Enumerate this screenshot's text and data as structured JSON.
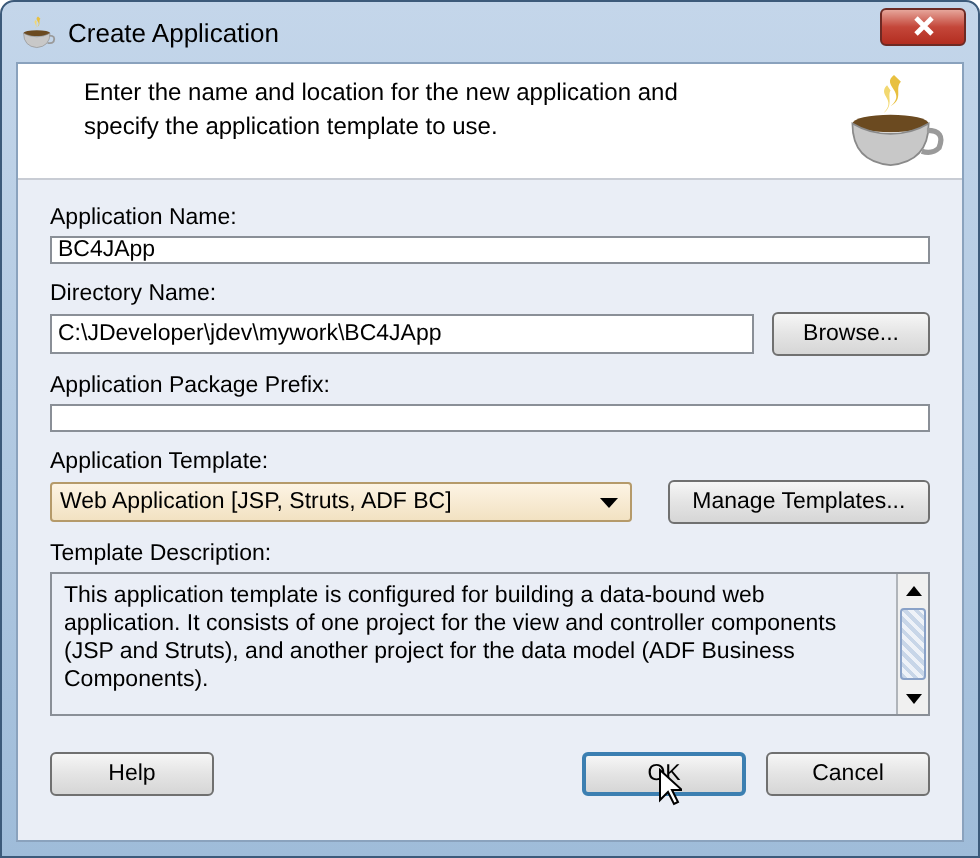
{
  "window": {
    "title": "Create Application"
  },
  "header": {
    "text": "Enter the name and location for the new application and specify the application template to use."
  },
  "fields": [
    {
      "kind": "text",
      "label": "Application Name:",
      "value": "BC4JApp"
    },
    {
      "kind": "text-button",
      "label": "Directory Name:",
      "value": "C:\\JDeveloper\\jdev\\mywork\\BC4JApp",
      "button": "Browse..."
    },
    {
      "kind": "text",
      "label": "Application Package Prefix:"
    },
    {
      "kind": "combo",
      "label": "Application Template:",
      "value": "Web Application [JSP, Struts, ADF BC]",
      "button": "Manage Templates..."
    },
    {
      "kind": "textarea",
      "label": "Template Description:",
      "value": "This application template is configured for building a data-bound web application. It consists of one project for the view and controller components (JSP and Struts), and another project for the data model (ADF Business Components)."
    }
  ],
  "buttons": [
    {
      "label": "Help",
      "default": false
    },
    {
      "label": "OK",
      "default": true
    },
    {
      "label": "Cancel",
      "default": false
    }
  ]
}
